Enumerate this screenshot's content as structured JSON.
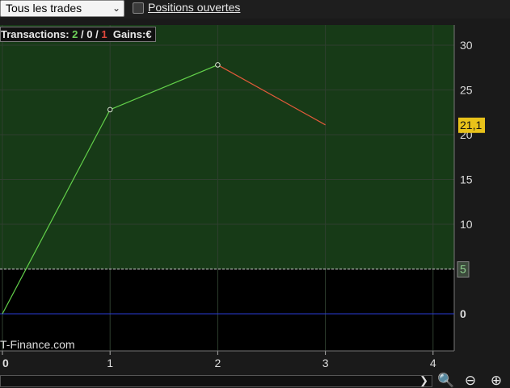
{
  "toolbar": {
    "trade_filter": "Tous les trades",
    "positions_label": "Positions ouvertes",
    "positions_checked": false
  },
  "info": {
    "label": "Transactions:",
    "wins": "2",
    "sep1": "/",
    "neutral": "0",
    "sep2": "/",
    "losses": "1",
    "gains_label": "Gains:",
    "currency": "€"
  },
  "brand": "T-Finance.com",
  "icons": [
    "chevron-down-icon",
    "chevron-right-icon",
    "zoom-reset-icon",
    "zoom-out-icon",
    "zoom-in-icon"
  ],
  "colors": {
    "background": "#000000",
    "positive_zone": "#173a17",
    "win_line": "#62d04a",
    "loss_line": "#e05a3a",
    "zero_line": "#2a3bd6",
    "last_value_badge": "#e8c21a",
    "threshold_badge": "#3c4a3c"
  },
  "chart_data": {
    "type": "line",
    "x": [
      0,
      1,
      2,
      3
    ],
    "y": [
      0,
      22.8,
      27.8,
      21.1
    ],
    "segment_colors": [
      "win",
      "win",
      "loss"
    ],
    "xlim": [
      0,
      4.2
    ],
    "ylim": [
      -4,
      32
    ],
    "x_ticks": [
      "0",
      "1",
      "2",
      "3",
      "4"
    ],
    "y_ticks": [
      "0",
      "5",
      "10",
      "15",
      "20",
      "25",
      "30"
    ],
    "last_value_label": "21,1",
    "threshold_value": 5,
    "threshold_label": "5",
    "zero_line": 0,
    "grid": true
  }
}
